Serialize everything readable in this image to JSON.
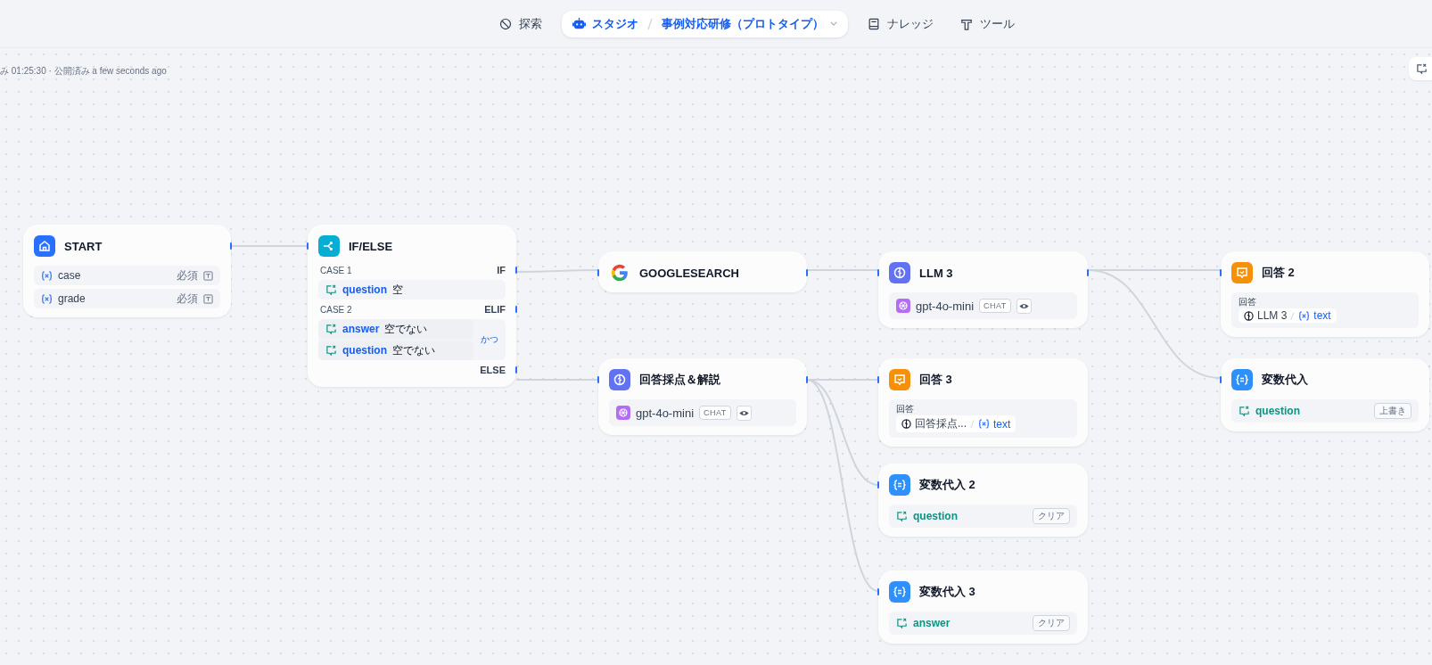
{
  "nav": [
    {
      "kind": "explore",
      "label": "探索",
      "selected": false
    },
    {
      "kind": "studio",
      "label": "スタジオ",
      "selected": true,
      "app": "事例対応研修（プロトタイプ）"
    },
    {
      "kind": "knowledge",
      "label": "ナレッジ",
      "selected": false
    },
    {
      "kind": "tools",
      "label": "ツール",
      "selected": false
    }
  ],
  "status": "み 01:25:30 · 公開済み a few seconds ago",
  "nodes": [
    {
      "kind": "start",
      "title": "START",
      "variables": [
        {
          "name": "case",
          "required": "必須"
        },
        {
          "name": "grade",
          "required": "必須"
        }
      ]
    },
    {
      "kind": "ifelse",
      "title": "IF/ELSE",
      "cases": [
        {
          "label": "CASE 1",
          "branch": "IF",
          "conditions": [
            {
              "variable": "question",
              "operator": "空"
            }
          ]
        },
        {
          "label": "CASE 2",
          "branch": "ELIF",
          "logic": "かつ",
          "conditions": [
            {
              "variable": "answer",
              "operator": "空でない"
            },
            {
              "variable": "question",
              "operator": "空でない"
            }
          ]
        }
      ],
      "else": "ELSE"
    },
    {
      "kind": "tool",
      "title": "GOOGLESEARCH"
    },
    {
      "kind": "llm",
      "title": "回答採点＆解説",
      "model": "gpt-4o-mini",
      "mode": "CHAT"
    },
    {
      "kind": "llm",
      "title": "LLM 3",
      "model": "gpt-4o-mini",
      "mode": "CHAT"
    },
    {
      "kind": "answer",
      "title": "回答 3",
      "label": "回答",
      "source": "回答採点...",
      "variable": "text"
    },
    {
      "kind": "assigner",
      "title": "変数代入 2",
      "variable": "question",
      "operation": "クリア"
    },
    {
      "kind": "assigner",
      "title": "変数代入 3",
      "variable": "answer",
      "operation": "クリア"
    },
    {
      "kind": "answer",
      "title": "回答 2",
      "label": "回答",
      "source": "LLM 3",
      "variable": "text"
    },
    {
      "kind": "assigner",
      "title": "変数代入",
      "variable": "question",
      "operation": "上書き"
    }
  ]
}
